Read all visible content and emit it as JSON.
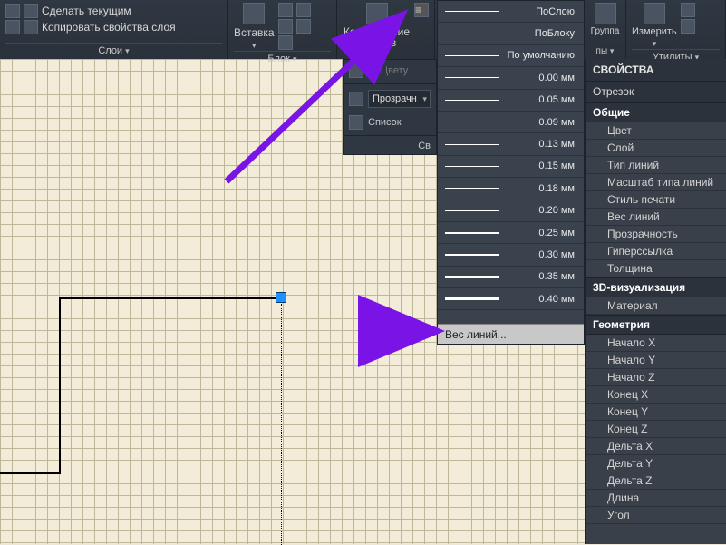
{
  "ribbon": {
    "layers": {
      "make_current": "Сделать текущим",
      "copy_props": "Копировать свойства слоя",
      "label": "Слои"
    },
    "block": {
      "insert": "Вставка",
      "label": "Блок"
    },
    "clipboard": {
      "copy_props": "Копирование свойств",
      "label": ""
    },
    "props": {
      "by_layer": "———— ПоСлою",
      "label": ""
    },
    "group": {
      "group": "Группа",
      "label": "пы"
    },
    "utils": {
      "measure": "Измерить",
      "label": "Утилиты"
    }
  },
  "panel2": {
    "by_color": "ПоЦвету",
    "transparency": "Прозрачн",
    "list": "Список",
    "footer": "Св"
  },
  "lineweights": {
    "items": [
      {
        "label": "ПоСлою",
        "w": 1
      },
      {
        "label": "ПоБлоку",
        "w": 1
      },
      {
        "label": "По умолчанию",
        "w": 1
      },
      {
        "label": "0.00 мм",
        "w": 1
      },
      {
        "label": "0.05 мм",
        "w": 1
      },
      {
        "label": "0.09 мм",
        "w": 1
      },
      {
        "label": "0.13 мм",
        "w": 1
      },
      {
        "label": "0.15 мм",
        "w": 1
      },
      {
        "label": "0.18 мм",
        "w": 1
      },
      {
        "label": "0.20 мм",
        "w": 1.5
      },
      {
        "label": "0.25 мм",
        "w": 2
      },
      {
        "label": "0.30 мм",
        "w": 2.5
      },
      {
        "label": "0.35 мм",
        "w": 3
      },
      {
        "label": "0.40 мм",
        "w": 3.5
      }
    ],
    "more": "Вес линий..."
  },
  "props_panel": {
    "title": "СВОЙСТВА",
    "object_type": "Отрезок",
    "sections": [
      {
        "name": "Общие",
        "rows": [
          "Цвет",
          "Слой",
          "Тип линий",
          "Масштаб типа линий",
          "Стиль печати",
          "Вес линий",
          "Прозрачность",
          "Гиперссылка",
          "Толщина"
        ]
      },
      {
        "name": "3D-визуализация",
        "rows": [
          "Материал"
        ]
      },
      {
        "name": "Геометрия",
        "rows": [
          "Начало X",
          "Начало Y",
          "Начало Z",
          "Конец X",
          "Конец Y",
          "Конец Z",
          "Дельта X",
          "Дельта Y",
          "Дельта Z",
          "Длина",
          "Угол"
        ]
      }
    ]
  }
}
